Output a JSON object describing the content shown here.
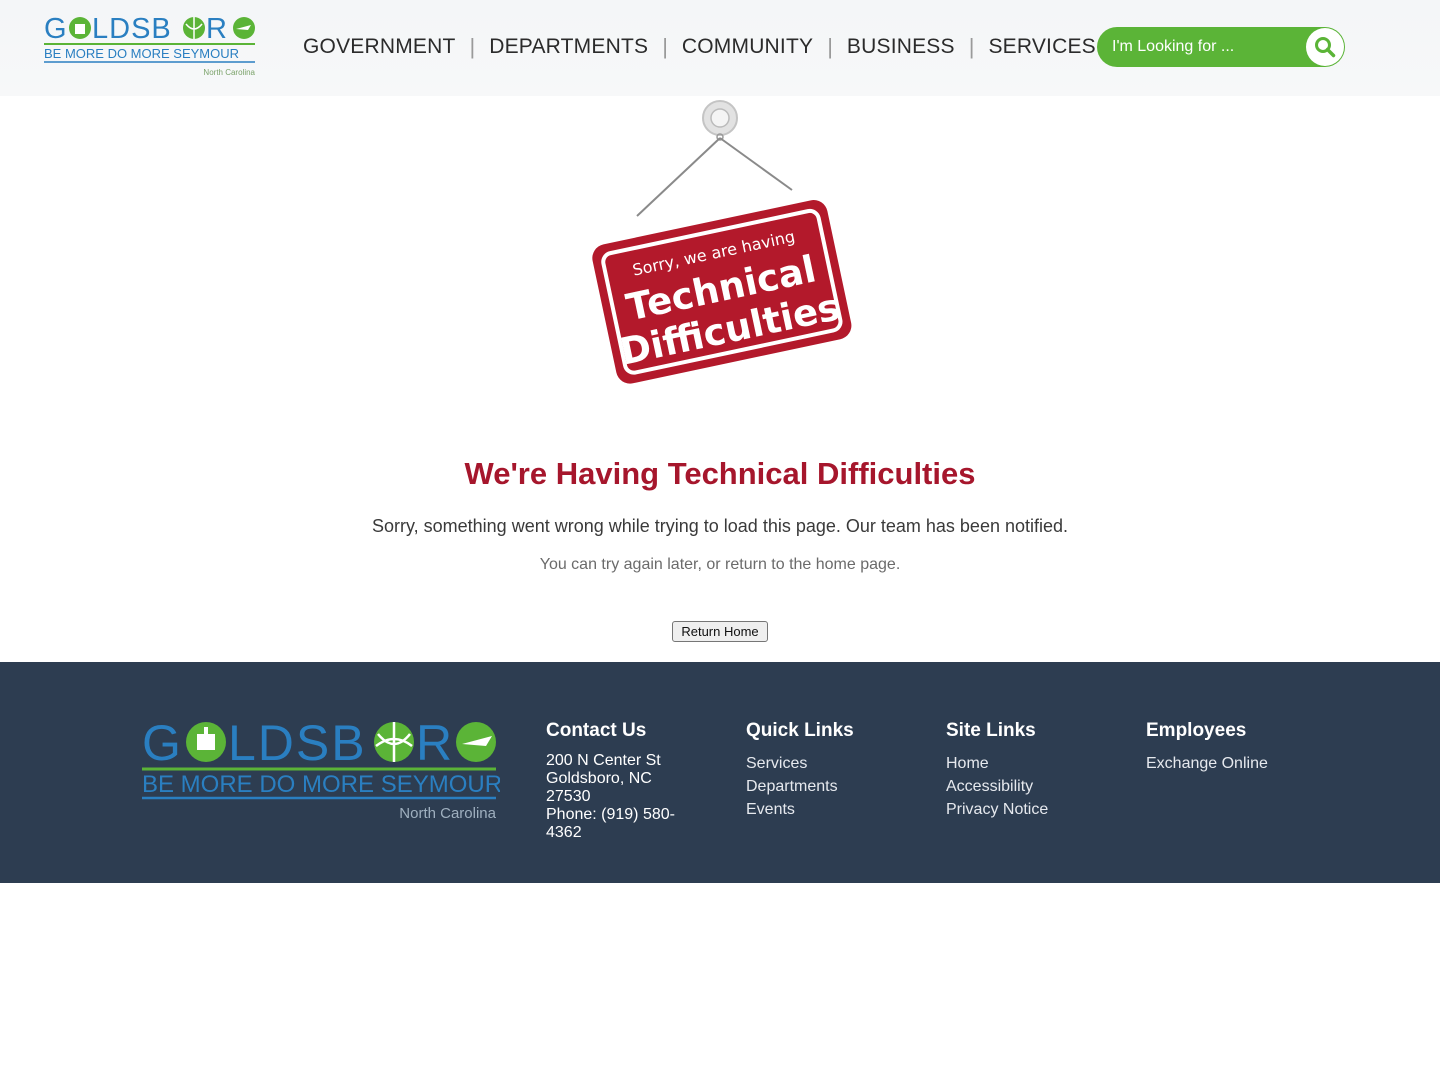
{
  "logo": {
    "name_left": "G",
    "name_mid": "LDSB",
    "name_right": "R",
    "tagline": "BE MORE  DO MORE  SEYMOUR",
    "state": "North Carolina"
  },
  "nav": {
    "items": [
      "GOVERNMENT",
      "DEPARTMENTS",
      "COMMUNITY",
      "BUSINESS",
      "SERVICES"
    ],
    "separator": "|"
  },
  "search": {
    "placeholder": "I'm Looking for ..."
  },
  "sign": {
    "line1": "Sorry, we are having",
    "line2": "Technical",
    "line3": "Difficulties"
  },
  "main": {
    "title": "We're Having Technical Difficulties",
    "message": "Sorry, something went wrong while trying to load this page. Our team has been notified.",
    "submessage": "You can try again later, or return to the home page.",
    "button": "Return Home"
  },
  "footer": {
    "contact": {
      "heading": "Contact Us",
      "lines": [
        "200 N Center St",
        "Goldsboro, NC",
        "27530",
        "Phone: (919) 580-",
        "4362"
      ]
    },
    "quick_links": {
      "heading": "Quick Links",
      "items": [
        "Services",
        "Departments",
        "Events"
      ]
    },
    "site_links": {
      "heading": "Site Links",
      "items": [
        "Home",
        "Accessibility",
        "Privacy Notice"
      ]
    },
    "employees": {
      "heading": "Employees",
      "items": [
        "Exchange Online"
      ]
    }
  },
  "colors": {
    "green": "#5bb437",
    "blue": "#2a7fc1",
    "red": "#a6162c",
    "footer": "#2d3d51"
  }
}
